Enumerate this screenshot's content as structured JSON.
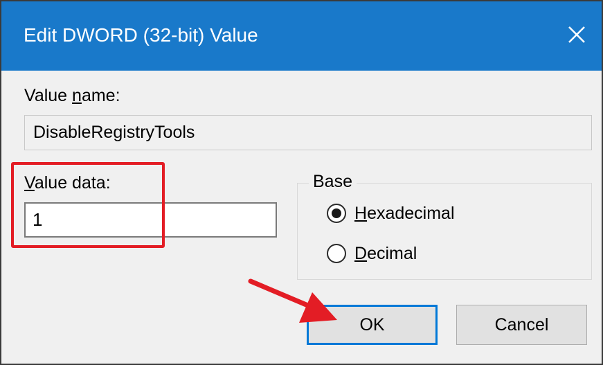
{
  "dialog": {
    "title": "Edit DWORD (32-bit) Value"
  },
  "value_name": {
    "label_prefix": "Value ",
    "label_accel": "n",
    "label_suffix": "ame:",
    "value": "DisableRegistryTools"
  },
  "value_data": {
    "label_accel": "V",
    "label_suffix": "alue data:",
    "value": "1"
  },
  "base": {
    "title": "Base",
    "options": [
      {
        "accel": "H",
        "rest": "exadecimal",
        "selected": true
      },
      {
        "accel": "D",
        "rest": "ecimal",
        "selected": false
      }
    ]
  },
  "buttons": {
    "ok": "OK",
    "cancel": "Cancel"
  },
  "annotation": {
    "highlight_color": "#e31d25"
  }
}
